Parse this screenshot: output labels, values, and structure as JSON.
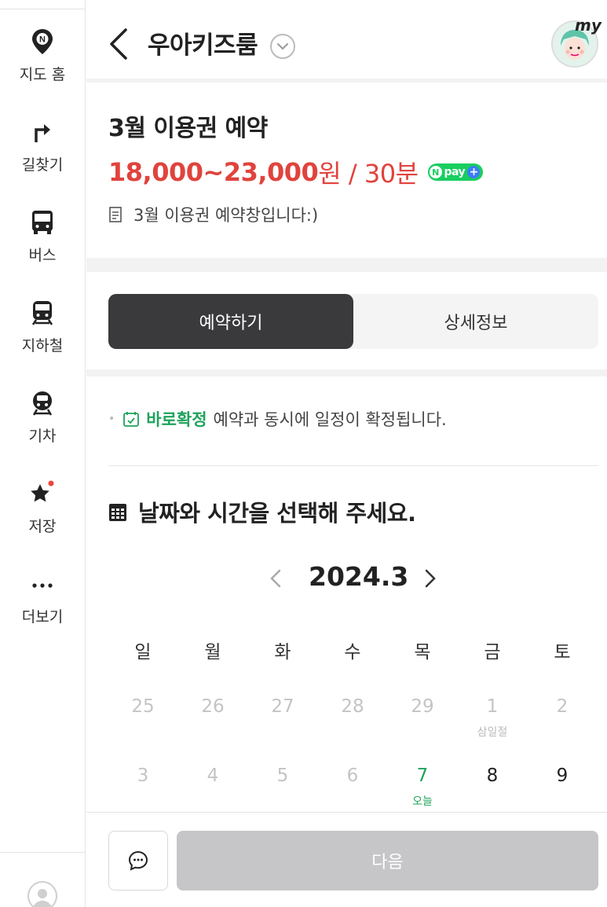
{
  "sidebar": {
    "items": [
      {
        "label": "지도 홈",
        "icon": "map-pin-n-icon"
      },
      {
        "label": "길찾기",
        "icon": "directions-arrow-icon"
      },
      {
        "label": "버스",
        "icon": "bus-icon"
      },
      {
        "label": "지하철",
        "icon": "subway-icon"
      },
      {
        "label": "기차",
        "icon": "train-icon"
      },
      {
        "label": "저장",
        "icon": "star-icon"
      },
      {
        "label": "더보기",
        "icon": "more-dots-icon"
      }
    ]
  },
  "header": {
    "title": "우아키즈룸",
    "my_label": "my"
  },
  "product": {
    "title": "3월 이용권 예약",
    "price": "18,000~23,000",
    "price_unit": "원 / 30분",
    "npay_label": "pay",
    "notice": "3월 이용권 예약창입니다:)"
  },
  "tabs": {
    "reserve": "예약하기",
    "details": "상세정보"
  },
  "confirm": {
    "highlight": "바로확정",
    "text": "예약과 동시에 일정이 확정됩니다."
  },
  "calendar": {
    "heading": "날짜와 시간을 선택해 주세요.",
    "month": "2024.3",
    "weekdays": [
      "일",
      "월",
      "화",
      "수",
      "목",
      "금",
      "토"
    ],
    "week1": [
      "25",
      "26",
      "27",
      "28",
      "29",
      "1",
      "2"
    ],
    "week1_holiday": "삼일절",
    "week2": [
      "3",
      "4",
      "5",
      "6",
      "7",
      "8",
      "9"
    ],
    "today_label": "오늘"
  },
  "footer": {
    "next_label": "다음"
  },
  "colors": {
    "accent_red": "#e0433d",
    "accent_green": "#1fa35b",
    "tab_active": "#3a3a3c",
    "disabled_button": "#c6c6c8"
  }
}
